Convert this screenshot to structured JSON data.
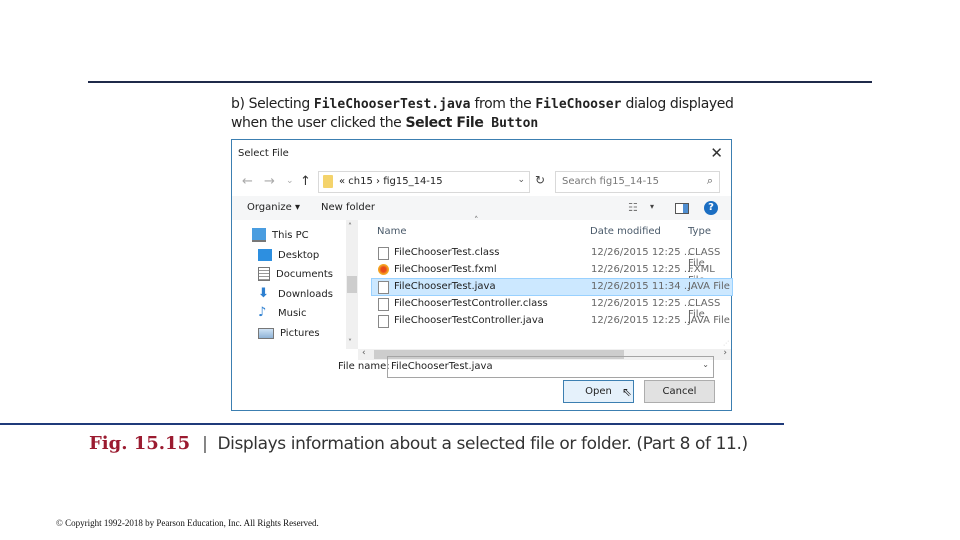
{
  "caption_b": {
    "prefix": "b) Selecting ",
    "file_code": "FileChooserTest.java",
    "mid1": " from the ",
    "class_code": "FileChooser",
    "mid2": " dialog displayed",
    "line2_prefix": "when the user clicked the ",
    "button_bold": "Select File",
    "button_code": " Button"
  },
  "dialog": {
    "title": "Select File",
    "close_glyph": "✕",
    "nav": {
      "back_glyph": "←",
      "forward_glyph": "→",
      "recent_glyph": "⌄",
      "up_glyph": "↑",
      "path": "«  ch15  ›  fig15_14-15",
      "path_dropdown_glyph": "⌄",
      "refresh_glyph": "↻",
      "search_placeholder": "Search fig15_14-15",
      "search_glyph": "⌕"
    },
    "toolbar": {
      "organize": "Organize ▾",
      "new_folder": "New folder",
      "view_glyph": "☷",
      "view_dropdown_glyph": "▾",
      "help_glyph": "?"
    },
    "sidebar": {
      "items": [
        {
          "label": "This PC",
          "icon": "computer-icon"
        },
        {
          "label": "Desktop",
          "icon": "desktop-icon"
        },
        {
          "label": "Documents",
          "icon": "documents-icon"
        },
        {
          "label": "Downloads",
          "icon": "downloads-icon"
        },
        {
          "label": "Music",
          "icon": "music-icon"
        },
        {
          "label": "Pictures",
          "icon": "pictures-icon"
        }
      ]
    },
    "columns": {
      "name": "Name",
      "date": "Date modified",
      "type": "Type"
    },
    "files": [
      {
        "name": "FileChooserTest.class",
        "date": "12/26/2015 12:25 ...",
        "type": "CLASS File",
        "icon": "file-icon",
        "selected": false
      },
      {
        "name": "FileChooserTest.fxml",
        "date": "12/26/2015 12:25 ...",
        "type": "FXML File",
        "icon": "fxml-file-icon",
        "selected": false
      },
      {
        "name": "FileChooserTest.java",
        "date": "12/26/2015 11:34 ...",
        "type": "JAVA File",
        "icon": "file-icon",
        "selected": true
      },
      {
        "name": "FileChooserTestController.class",
        "date": "12/26/2015 12:25 ...",
        "type": "CLASS File",
        "icon": "file-icon",
        "selected": false
      },
      {
        "name": "FileChooserTestController.java",
        "date": "12/26/2015 12:25 ...",
        "type": "JAVA File",
        "icon": "file-icon",
        "selected": false
      }
    ],
    "file_name_label": "File name:",
    "file_name_value": "FileChooserTest.java",
    "open_label": "Open",
    "cancel_label": "Cancel"
  },
  "figure_caption": {
    "number": "Fig. 15.15",
    "separator": "|",
    "text": "Displays information about a selected file or folder. (Part 8 of 11.)"
  },
  "copyright": "© Copyright 1992-2018 by Pearson Education, Inc. All Rights Reserved.",
  "colors": {
    "rule": "#1f2a4a",
    "fig_number": "#9b1b30",
    "dialog_border": "#3c7fb1",
    "selection": "#cce8ff"
  }
}
